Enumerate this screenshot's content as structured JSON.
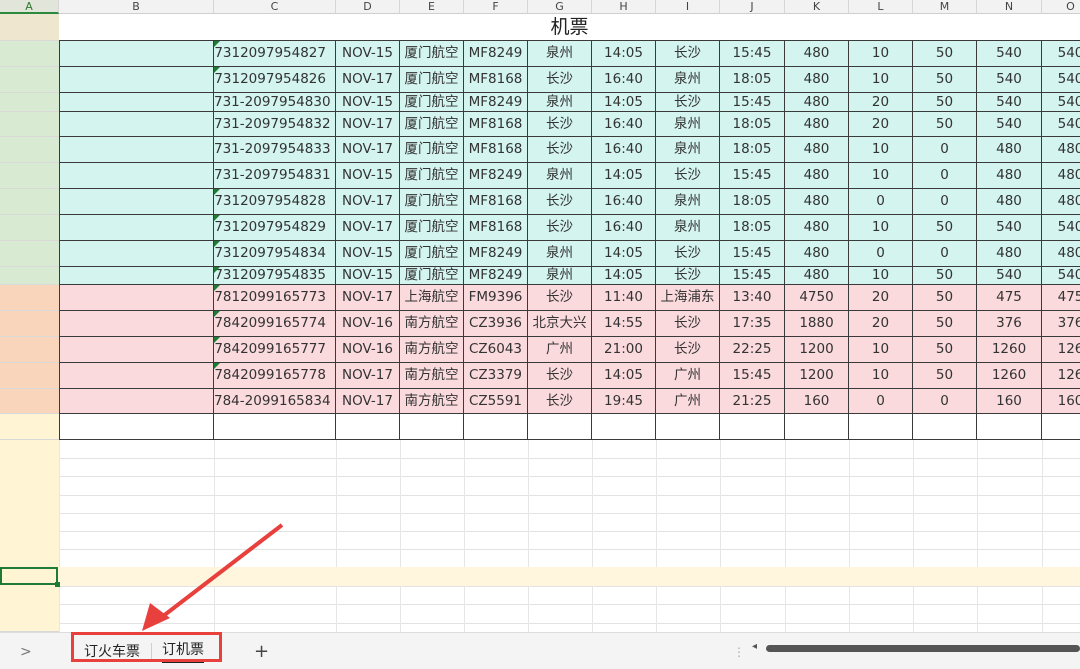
{
  "sheet_title": "机票",
  "columns": [
    "A",
    "B",
    "C",
    "D",
    "E",
    "F",
    "G",
    "H",
    "I",
    "J",
    "K",
    "L",
    "M",
    "N",
    "O"
  ],
  "selected_column": "A",
  "flights": [
    {
      "ticket": "7312097954827",
      "date": "NOV-15",
      "airline": "厦门航空",
      "flight": "MF8249",
      "from": "泉州",
      "dep": "14:05",
      "to": "长沙",
      "arr": "15:45",
      "fare": "480",
      "fuel": "10",
      "fee": "50",
      "total": "540",
      "o": "540",
      "group": "cyan",
      "tri": true
    },
    {
      "ticket": "7312097954826",
      "date": "NOV-17",
      "airline": "厦门航空",
      "flight": "MF8168",
      "from": "长沙",
      "dep": "16:40",
      "to": "泉州",
      "arr": "18:05",
      "fare": "480",
      "fuel": "10",
      "fee": "50",
      "total": "540",
      "o": "540",
      "group": "cyan",
      "tri": true
    },
    {
      "ticket": "731-2097954830",
      "date": "NOV-15",
      "airline": "厦门航空",
      "flight": "MF8249",
      "from": "泉州",
      "dep": "14:05",
      "to": "长沙",
      "arr": "15:45",
      "fare": "480",
      "fuel": "20",
      "fee": "50",
      "total": "540",
      "o": "540",
      "group": "cyan",
      "tri": false
    },
    {
      "ticket": "731-2097954832",
      "date": "NOV-17",
      "airline": "厦门航空",
      "flight": "MF8168",
      "from": "长沙",
      "dep": "16:40",
      "to": "泉州",
      "arr": "18:05",
      "fare": "480",
      "fuel": "20",
      "fee": "50",
      "total": "540",
      "o": "540",
      "group": "cyan",
      "tri": false
    },
    {
      "ticket": "731-2097954833",
      "date": "NOV-17",
      "airline": "厦门航空",
      "flight": "MF8168",
      "from": "长沙",
      "dep": "16:40",
      "to": "泉州",
      "arr": "18:05",
      "fare": "480",
      "fuel": "10",
      "fee": "0",
      "total": "480",
      "o": "480",
      "group": "cyan",
      "tri": false
    },
    {
      "ticket": "731-2097954831",
      "date": "NOV-15",
      "airline": "厦门航空",
      "flight": "MF8249",
      "from": "泉州",
      "dep": "14:05",
      "to": "长沙",
      "arr": "15:45",
      "fare": "480",
      "fuel": "10",
      "fee": "0",
      "total": "480",
      "o": "480",
      "group": "cyan",
      "tri": false
    },
    {
      "ticket": "7312097954828",
      "date": "NOV-17",
      "airline": "厦门航空",
      "flight": "MF8168",
      "from": "长沙",
      "dep": "16:40",
      "to": "泉州",
      "arr": "18:05",
      "fare": "480",
      "fuel": "0",
      "fee": "0",
      "total": "480",
      "o": "480",
      "group": "cyan",
      "tri": true
    },
    {
      "ticket": "7312097954829",
      "date": "NOV-17",
      "airline": "厦门航空",
      "flight": "MF8168",
      "from": "长沙",
      "dep": "16:40",
      "to": "泉州",
      "arr": "18:05",
      "fare": "480",
      "fuel": "10",
      "fee": "50",
      "total": "540",
      "o": "540",
      "group": "cyan",
      "tri": true
    },
    {
      "ticket": "7312097954834",
      "date": "NOV-15",
      "airline": "厦门航空",
      "flight": "MF8249",
      "from": "泉州",
      "dep": "14:05",
      "to": "长沙",
      "arr": "15:45",
      "fare": "480",
      "fuel": "0",
      "fee": "0",
      "total": "480",
      "o": "480",
      "group": "cyan",
      "tri": true
    },
    {
      "ticket": "7312097954835",
      "date": "NOV-15",
      "airline": "厦门航空",
      "flight": "MF8249",
      "from": "泉州",
      "dep": "14:05",
      "to": "长沙",
      "arr": "15:45",
      "fare": "480",
      "fuel": "10",
      "fee": "50",
      "total": "540",
      "o": "540",
      "group": "cyan",
      "tri": true
    },
    {
      "ticket": "7812099165773",
      "date": "NOV-17",
      "airline": "上海航空",
      "flight": "FM9396",
      "from": "长沙",
      "dep": "11:40",
      "to": "上海浦东",
      "arr": "13:40",
      "fare": "4750",
      "fuel": "20",
      "fee": "50",
      "total": "475",
      "o": "475",
      "group": "pink",
      "tri": true
    },
    {
      "ticket": "7842099165774",
      "date": "NOV-16",
      "airline": "南方航空",
      "flight": "CZ3936",
      "from": "北京大兴",
      "dep": "14:55",
      "to": "长沙",
      "arr": "17:35",
      "fare": "1880",
      "fuel": "20",
      "fee": "50",
      "total": "376",
      "o": "376",
      "group": "pink",
      "tri": true
    },
    {
      "ticket": "7842099165777",
      "date": "NOV-16",
      "airline": "南方航空",
      "flight": "CZ6043",
      "from": "广州",
      "dep": "21:00",
      "to": "长沙",
      "arr": "22:25",
      "fare": "1200",
      "fuel": "10",
      "fee": "50",
      "total": "1260",
      "o": "126",
      "group": "pink",
      "tri": true
    },
    {
      "ticket": "7842099165778",
      "date": "NOV-17",
      "airline": "南方航空",
      "flight": "CZ3379",
      "from": "长沙",
      "dep": "14:05",
      "to": "广州",
      "arr": "15:45",
      "fare": "1200",
      "fuel": "10",
      "fee": "50",
      "total": "1260",
      "o": "126",
      "group": "pink",
      "tri": true
    },
    {
      "ticket": "784-2099165834",
      "date": "NOV-17",
      "airline": "南方航空",
      "flight": "CZ5591",
      "from": "长沙",
      "dep": "19:45",
      "to": "广州",
      "arr": "21:25",
      "fare": "160",
      "fuel": "0",
      "fee": "0",
      "total": "160",
      "o": "160",
      "group": "pink",
      "tri": false
    }
  ],
  "tabs": {
    "expand_label": ">",
    "items": [
      {
        "label": "订火车票",
        "active": false
      },
      {
        "label": "订机票",
        "active": true
      }
    ],
    "add_label": "+",
    "more_label": "⋮"
  },
  "colors": {
    "cyan_row": "#d3f4ef",
    "pink_row": "#fadadd",
    "green_head": "#d9ead3",
    "orange_head": "#f9d5bb",
    "yellow_head": "#fff4d3",
    "highlight_red": "#e8403c",
    "active_green": "#1e7b34"
  }
}
